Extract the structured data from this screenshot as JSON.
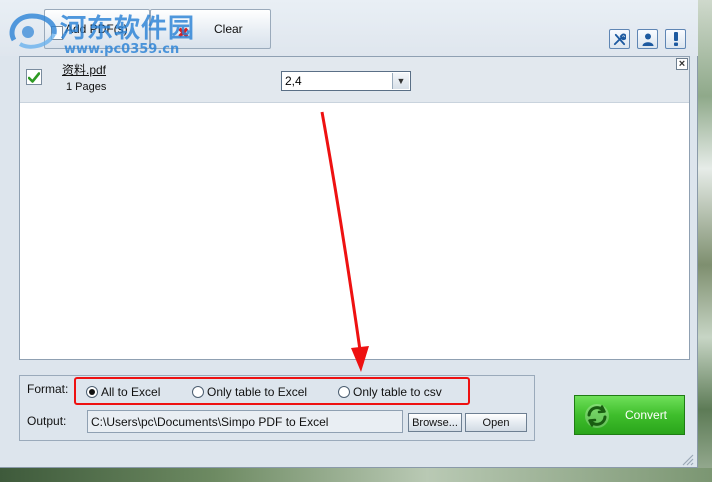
{
  "toolbar": {
    "add_label": "Add PDF(s)",
    "clear_label": "Clear",
    "tools_icon": "wrench-icon",
    "user_icon": "user-icon",
    "info_icon": "exclamation-icon"
  },
  "watermark": {
    "title": "河东软件园",
    "url": "www.pc0359.cn"
  },
  "file_list": {
    "items": [
      {
        "name": "资料.pdf",
        "pages_text": "1 Pages",
        "page_range": "2,4",
        "checked": true
      }
    ]
  },
  "format": {
    "label": "Format:",
    "options": [
      {
        "label": "All to Excel",
        "selected": true
      },
      {
        "label": "Only table to Excel",
        "selected": false
      },
      {
        "label": "Only table to csv",
        "selected": false
      }
    ]
  },
  "output": {
    "label": "Output:",
    "path": "C:\\Users\\pc\\Documents\\Simpo PDF to Excel",
    "browse_label": "Browse...",
    "open_label": "Open"
  },
  "convert": {
    "label": "Convert"
  },
  "colors": {
    "accent_red": "#ee1111",
    "convert_green": "#3fbe2c",
    "watermark_blue": "#2a82d6"
  }
}
